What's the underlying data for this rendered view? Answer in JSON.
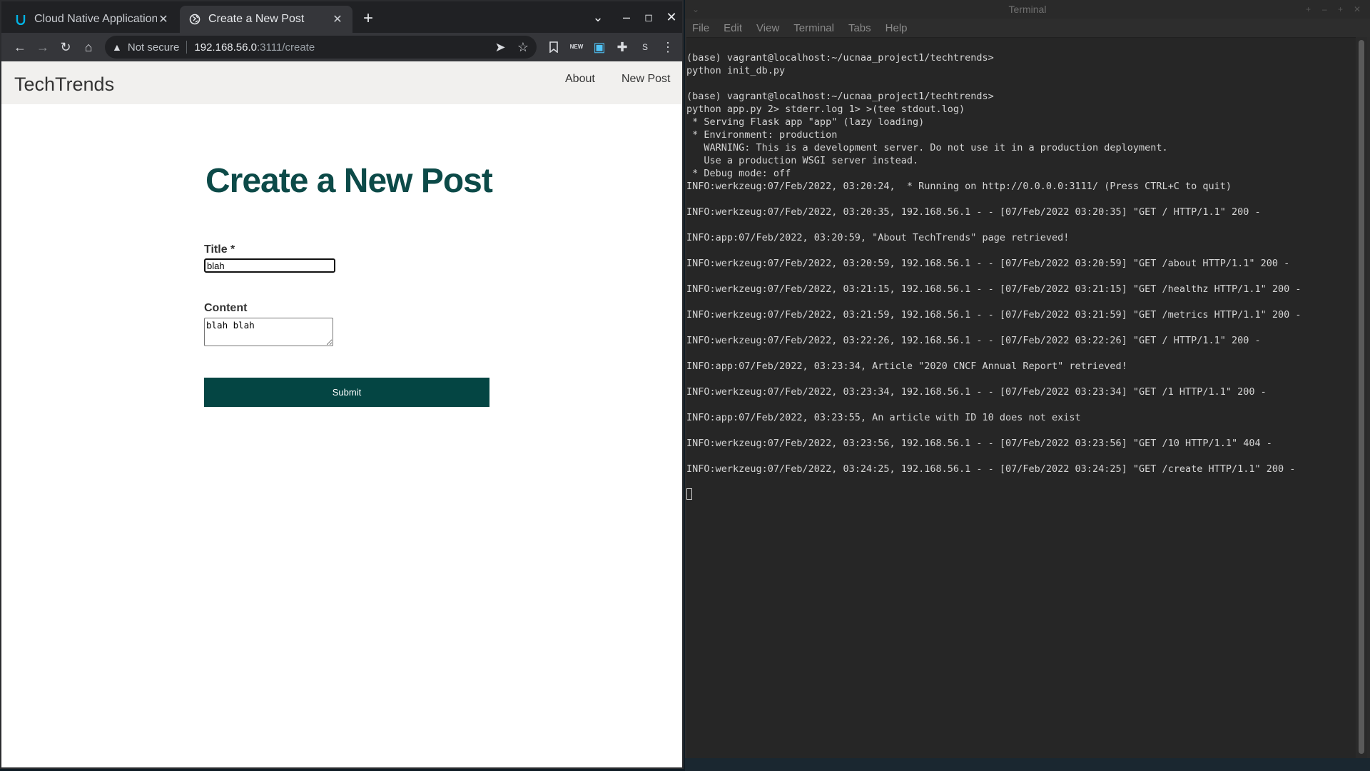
{
  "browser": {
    "tabs": [
      {
        "title": "Cloud Native Application",
        "active": false,
        "favicon": "udacity-icon"
      },
      {
        "title": "Create a New Post",
        "active": true,
        "favicon": "globe-icon"
      }
    ],
    "address": {
      "security": "Not secure",
      "host": "192.168.56.0",
      "path": ":3111/create"
    },
    "toolbar_extra": {
      "profile_initial": "S",
      "ext_badge": "NEW"
    }
  },
  "site": {
    "brand": "TechTrends",
    "nav": {
      "about": "About",
      "new_post": "New Post"
    },
    "heading": "Create a New Post",
    "form": {
      "title_label": "Title *",
      "title_value": "blah",
      "content_label": "Content",
      "content_value": "blah blah",
      "submit_label": "Submit"
    }
  },
  "terminal": {
    "window_title": "Terminal",
    "menu": [
      "File",
      "Edit",
      "View",
      "Terminal",
      "Tabs",
      "Help"
    ],
    "lines": [
      "(base) vagrant@localhost:~/ucnaa_project1/techtrends>",
      "python init_db.py",
      "",
      "(base) vagrant@localhost:~/ucnaa_project1/techtrends>",
      "python app.py 2> stderr.log 1> >(tee stdout.log)",
      " * Serving Flask app \"app\" (lazy loading)",
      " * Environment: production",
      "   WARNING: This is a development server. Do not use it in a production deployment.",
      "   Use a production WSGI server instead.",
      " * Debug mode: off",
      "INFO:werkzeug:07/Feb/2022, 03:20:24,  * Running on http://0.0.0.0:3111/ (Press CTRL+C to quit)",
      "",
      "INFO:werkzeug:07/Feb/2022, 03:20:35, 192.168.56.1 - - [07/Feb/2022 03:20:35] \"GET / HTTP/1.1\" 200 -",
      "",
      "INFO:app:07/Feb/2022, 03:20:59, \"About TechTrends\" page retrieved!",
      "",
      "INFO:werkzeug:07/Feb/2022, 03:20:59, 192.168.56.1 - - [07/Feb/2022 03:20:59] \"GET /about HTTP/1.1\" 200 -",
      "",
      "INFO:werkzeug:07/Feb/2022, 03:21:15, 192.168.56.1 - - [07/Feb/2022 03:21:15] \"GET /healthz HTTP/1.1\" 200 -",
      "",
      "INFO:werkzeug:07/Feb/2022, 03:21:59, 192.168.56.1 - - [07/Feb/2022 03:21:59] \"GET /metrics HTTP/1.1\" 200 -",
      "",
      "INFO:werkzeug:07/Feb/2022, 03:22:26, 192.168.56.1 - - [07/Feb/2022 03:22:26] \"GET / HTTP/1.1\" 200 -",
      "",
      "INFO:app:07/Feb/2022, 03:23:34, Article \"2020 CNCF Annual Report\" retrieved!",
      "",
      "INFO:werkzeug:07/Feb/2022, 03:23:34, 192.168.56.1 - - [07/Feb/2022 03:23:34] \"GET /1 HTTP/1.1\" 200 -",
      "",
      "INFO:app:07/Feb/2022, 03:23:55, An article with ID 10 does not exist",
      "",
      "INFO:werkzeug:07/Feb/2022, 03:23:56, 192.168.56.1 - - [07/Feb/2022 03:23:56] \"GET /10 HTTP/1.1\" 404 -",
      "",
      "INFO:werkzeug:07/Feb/2022, 03:24:25, 192.168.56.1 - - [07/Feb/2022 03:24:25] \"GET /create HTTP/1.1\" 200 -",
      ""
    ]
  },
  "colors": {
    "heading": "#0c4a48",
    "submit_bg": "#044543",
    "terminal_bg": "#262626"
  }
}
